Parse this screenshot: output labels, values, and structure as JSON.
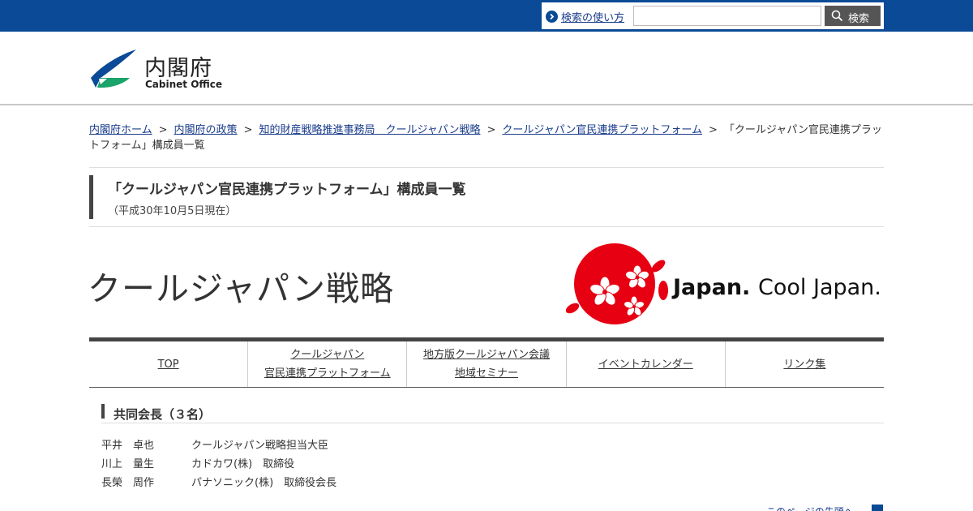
{
  "search": {
    "help_label": "検索の使い方",
    "input_value": "",
    "input_placeholder": "",
    "button_label": "検索"
  },
  "header": {
    "logo_jp": "内閣府",
    "logo_en": "Cabinet Office"
  },
  "breadcrumb": {
    "items": [
      "内閣府ホーム",
      "内閣府の政策",
      "知的財産戦略推進事務局　クールジャパン戦略",
      "クールジャパン官民連携プラットフォーム"
    ],
    "current": "「クールジャパン官民連携プラットフォーム」構成員一覧",
    "separator": ">"
  },
  "page": {
    "title": "「クールジャパン官民連携プラットフォーム」構成員一覧",
    "date": "（平成30年10月5日現在）"
  },
  "banner": {
    "title": "クールジャパン戦略",
    "logo_bold": "Japan.",
    "logo_light": "Cool Japan.",
    "colors": {
      "circle": "#e60012"
    }
  },
  "nav": {
    "items": [
      {
        "lines": [
          "TOP"
        ]
      },
      {
        "lines": [
          "クールジャパン",
          "官民連携プラットフォーム"
        ]
      },
      {
        "lines": [
          "地方版クールジャパン会議",
          "地域セミナー"
        ]
      },
      {
        "lines": [
          "イベントカレンダー"
        ]
      },
      {
        "lines": [
          "リンク集"
        ]
      }
    ]
  },
  "section": {
    "heading": "共同会長（３名）",
    "members": [
      {
        "name": "平井　卓也",
        "role": "クールジャパン戦略担当大臣"
      },
      {
        "name": "川上　量生",
        "role": "カドカワ(株)　取締役"
      },
      {
        "name": "長榮　周作",
        "role": "パナソニック(株)　取締役会長"
      }
    ]
  },
  "footer": {
    "eval_link": "このページの先頭へ"
  },
  "colors": {
    "topbar": "#0a4a96",
    "link": "#1a3c8c"
  }
}
